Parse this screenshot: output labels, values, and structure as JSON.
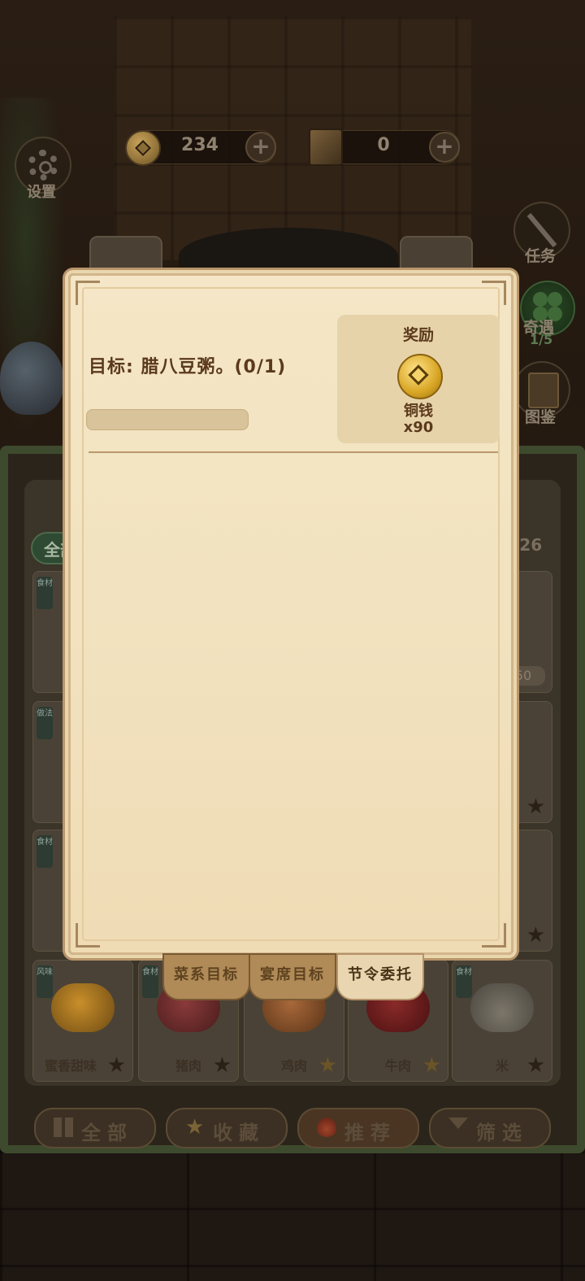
{
  "currency": {
    "coins": "234",
    "books": "0"
  },
  "side": {
    "settings_label": "设置",
    "task_label": "任务",
    "encounter_label": "奇遇",
    "encounter_count": "1/5",
    "atlas_label": "图鉴"
  },
  "background_panel": {
    "filter_tab_partial": "全部",
    "count_partial": "/26",
    "price_partial": "50",
    "tiles": [
      {
        "tag": "风味",
        "name": "蜜香甜味",
        "star": "filled"
      },
      {
        "tag": "食材",
        "name": "猪肉",
        "star": "filled"
      },
      {
        "tag": "",
        "name": "鸡肉",
        "star": "gold"
      },
      {
        "tag": "",
        "name": "牛肉",
        "star": "gold"
      },
      {
        "tag": "食材",
        "name": "米",
        "star": "filled"
      }
    ],
    "bottom_buttons": [
      {
        "label": "全部",
        "icon": "grid-icon"
      },
      {
        "label": "收藏",
        "icon": "star-icon"
      },
      {
        "label": "推荐",
        "icon": "flame-icon"
      },
      {
        "label": "筛选",
        "icon": "filter-icon"
      }
    ]
  },
  "tabs": [
    {
      "label": "菜系目标",
      "active": false
    },
    {
      "label": "宴席目标",
      "active": false
    },
    {
      "label": "节令委托",
      "active": true
    }
  ],
  "dialog": {
    "goal": "目标: 腊八豆粥。(0/1)",
    "progress": 0,
    "reward": {
      "title": "奖励",
      "item_name": "铜钱",
      "item_qty": "x90",
      "item_icon": "copper-coin-icon"
    }
  }
}
